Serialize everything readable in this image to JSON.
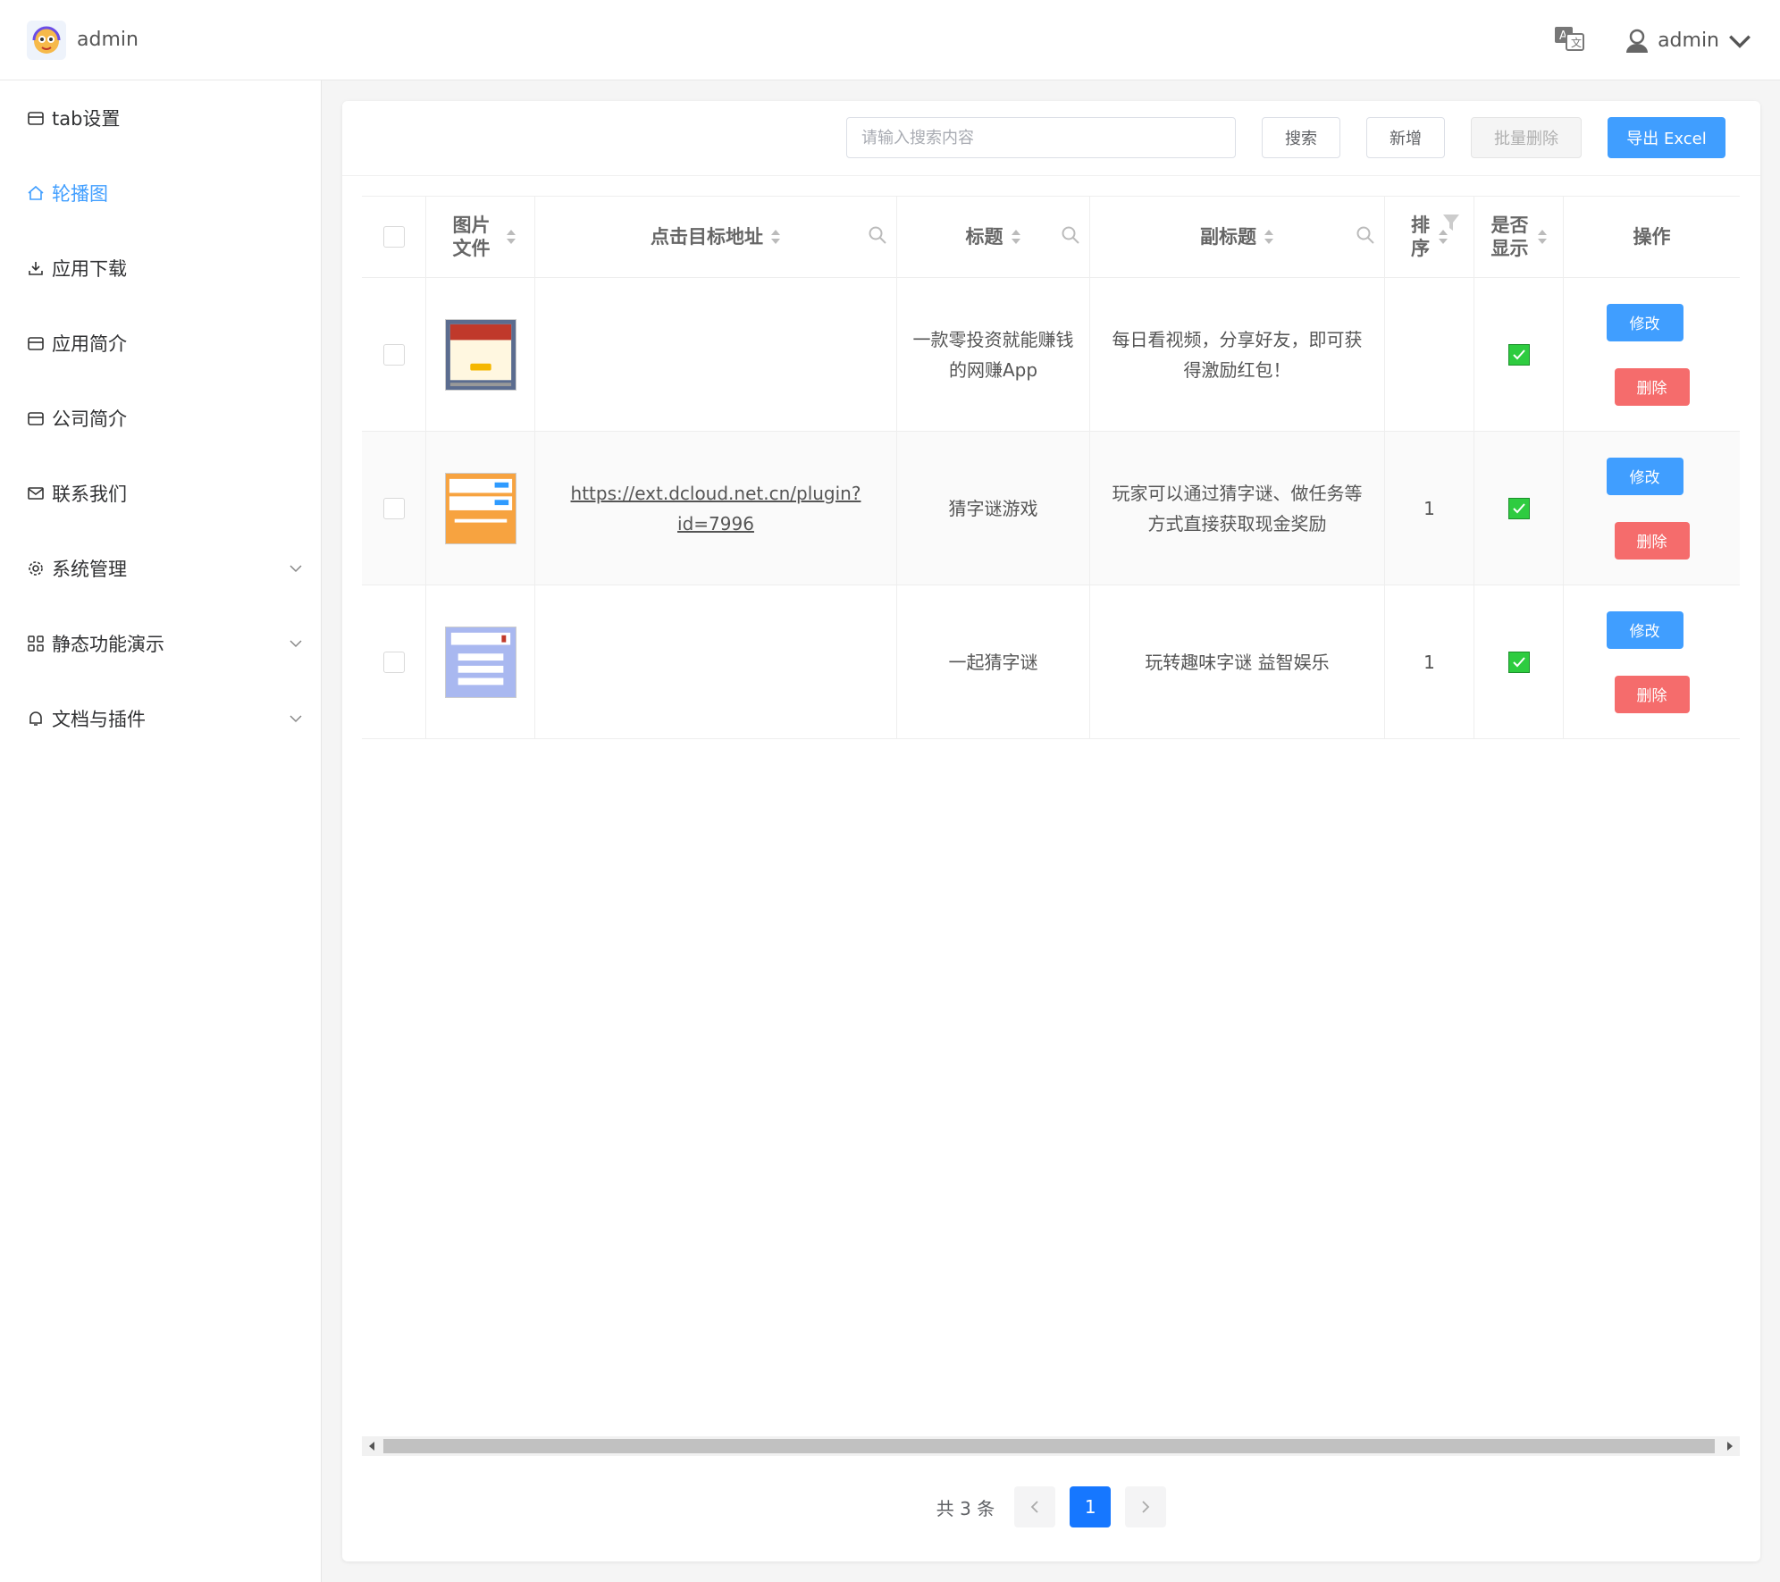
{
  "header": {
    "brand": "admin",
    "user_name": "admin"
  },
  "sidebar": {
    "items": [
      {
        "label": "tab设置",
        "icon": "box-icon",
        "active": false,
        "expandable": false
      },
      {
        "label": "轮播图",
        "icon": "home-icon",
        "active": true,
        "expandable": false
      },
      {
        "label": "应用下载",
        "icon": "download-icon",
        "active": false,
        "expandable": false
      },
      {
        "label": "应用简介",
        "icon": "box-icon",
        "active": false,
        "expandable": false
      },
      {
        "label": "公司简介",
        "icon": "box-icon",
        "active": false,
        "expandable": false
      },
      {
        "label": "联系我们",
        "icon": "mail-icon",
        "active": false,
        "expandable": false
      },
      {
        "label": "系统管理",
        "icon": "gear-icon",
        "active": false,
        "expandable": true
      },
      {
        "label": "静态功能演示",
        "icon": "grid-icon",
        "active": false,
        "expandable": true
      },
      {
        "label": "文档与插件",
        "icon": "bell-icon",
        "active": false,
        "expandable": true
      }
    ]
  },
  "toolbar": {
    "search_placeholder": "请输入搜索内容",
    "search_label": "搜索",
    "add_label": "新增",
    "batch_delete_label": "批量删除",
    "export_label": "导出 Excel"
  },
  "table": {
    "columns": {
      "image": "图片文件",
      "url": "点击目标地址",
      "title": "标题",
      "subtitle": "副标题",
      "sort": "排序",
      "show": "是否显示",
      "ops": "操作"
    },
    "rows": [
      {
        "url": "",
        "title": "一款零投资就能赚钱的网赚App",
        "subtitle": "每日看视频，分享好友，即可获得激励红包！",
        "sort": "",
        "show": true
      },
      {
        "url": "https://ext.dcloud.net.cn/plugin?id=7996",
        "title": "猜字谜游戏",
        "subtitle": "玩家可以通过猜字谜、做任务等方式直接获取现金奖励",
        "sort": "1",
        "show": true
      },
      {
        "url": "",
        "title": "一起猜字谜",
        "subtitle": "玩转趣味字谜 益智娱乐",
        "sort": "1",
        "show": true
      }
    ],
    "edit_label": "修改",
    "delete_label": "删除"
  },
  "pagination": {
    "total_text": "共 3 条",
    "current_page": "1"
  },
  "colors": {
    "primary": "#409eff",
    "danger": "#f56c6c",
    "page_active": "#1677ff",
    "check_green": "#2ecc40"
  }
}
